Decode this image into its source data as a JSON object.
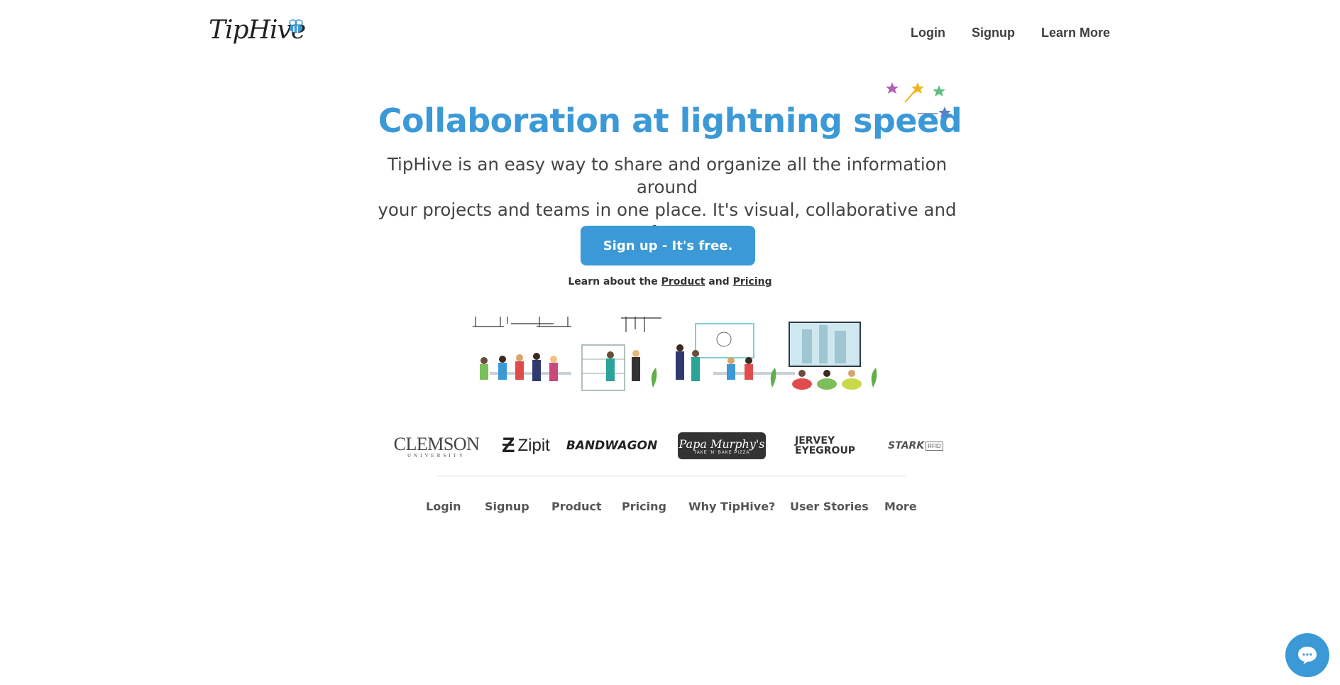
{
  "header": {
    "logo_text": "TipHive",
    "nav": [
      "Login",
      "Signup",
      "Learn More"
    ]
  },
  "hero": {
    "title": "Collaboration at lightning speed",
    "subtitle_line1": "TipHive is an easy way to share and organize all the information around",
    "subtitle_line2": "your projects and teams in one place. It's visual, collaborative and fun!",
    "cta_label": "Sign up - It's free.",
    "learn_prefix": "Learn about the",
    "learn_product": "Product",
    "learn_and": "and",
    "learn_pricing": "Pricing"
  },
  "clients": {
    "clemson": "CLEMSON",
    "clemson_sub": "UNIVERSITY",
    "zipit": "Zipit",
    "bandwagon": "BANDWAGON",
    "papa": "Papa Murphy's",
    "papa_sub": "TAKE 'N' BAKE PIZZA",
    "jervey_1": "JERVEY",
    "jervey_2": "EYEGROUP",
    "stark": "STARK",
    "stark_sub": "RFID"
  },
  "footer": {
    "links": [
      "Login",
      "Signup",
      "Product",
      "Pricing",
      "Why TipHive?",
      "User Stories",
      "More"
    ]
  },
  "colors": {
    "accent": "#3a99d6",
    "text": "#444444",
    "star_purple": "#b35fb5",
    "star_gold": "#f2b21c",
    "star_green": "#5cbf80",
    "star_blue": "#5b7fc9"
  },
  "icons": {
    "chat": "chat-bubble-icon",
    "bee": "bee-icon",
    "stars": "stars-decoration-icon"
  }
}
